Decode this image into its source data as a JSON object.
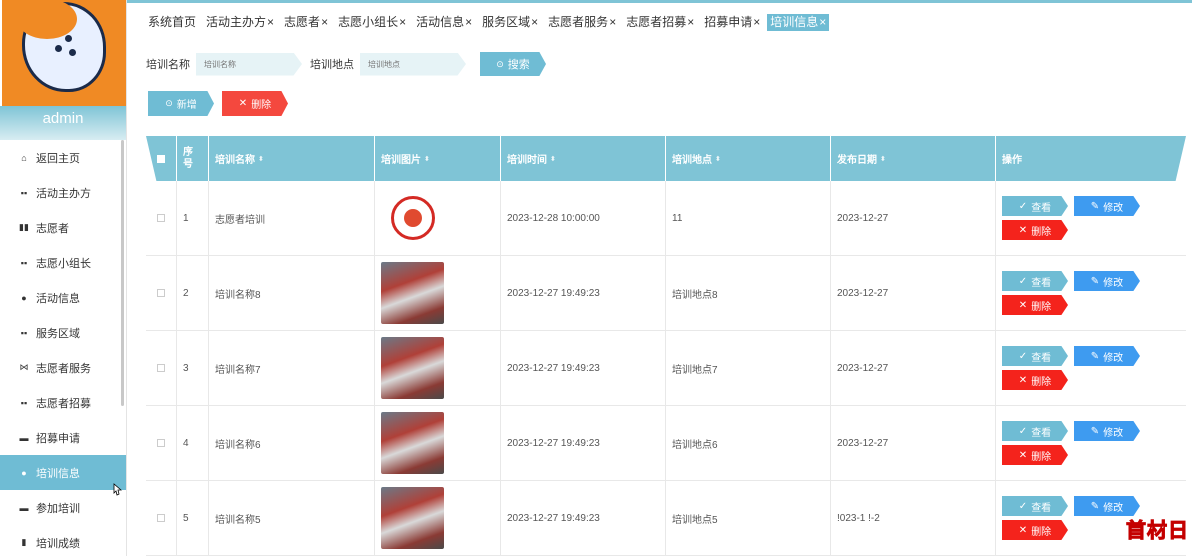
{
  "sidebar": {
    "username": "admin",
    "items": [
      {
        "label": "返回主页",
        "icon": "home-icon",
        "glyph": "⌂"
      },
      {
        "label": "活动主办方",
        "icon": "grid-icon",
        "glyph": "▪▪"
      },
      {
        "label": "志愿者",
        "icon": "building-icon",
        "glyph": "▮▮"
      },
      {
        "label": "志愿小组长",
        "icon": "grid-icon",
        "glyph": "▪▪"
      },
      {
        "label": "活动信息",
        "icon": "location-pin-icon",
        "glyph": "●"
      },
      {
        "label": "服务区域",
        "icon": "grid-icon",
        "glyph": "▪▪"
      },
      {
        "label": "志愿者服务",
        "icon": "bow-icon",
        "glyph": "⋈"
      },
      {
        "label": "志愿者招募",
        "icon": "grid-icon",
        "glyph": "▪▪"
      },
      {
        "label": "招募申请",
        "icon": "briefcase-icon",
        "glyph": "▬"
      },
      {
        "label": "培训信息",
        "icon": "user-icon",
        "glyph": "●",
        "active": true
      },
      {
        "label": "参加培训",
        "icon": "comment-icon",
        "glyph": "▬"
      },
      {
        "label": "培训成绩",
        "icon": "clipboard-icon",
        "glyph": "▮"
      }
    ]
  },
  "tabs": [
    {
      "label": "系统首页",
      "closable": false
    },
    {
      "label": "活动主办方",
      "closable": true
    },
    {
      "label": "志愿者",
      "closable": true
    },
    {
      "label": "志愿小组长",
      "closable": true
    },
    {
      "label": "活动信息",
      "closable": true
    },
    {
      "label": "服务区域",
      "closable": true
    },
    {
      "label": "志愿者服务",
      "closable": true
    },
    {
      "label": "志愿者招募",
      "closable": true
    },
    {
      "label": "招募申请",
      "closable": true
    },
    {
      "label": "培训信息",
      "closable": true,
      "active": true
    }
  ],
  "search": {
    "name_label": "培训名称",
    "name_placeholder": "培训名称",
    "location_label": "培训地点",
    "location_placeholder": "培训地点",
    "search_button": "搜索"
  },
  "actions": {
    "add_button": "新增",
    "delete_button": "删除"
  },
  "table": {
    "columns": [
      "序号",
      "培训名称",
      "培训图片",
      "培训时间",
      "培训地点",
      "发布日期",
      "操作"
    ],
    "view_label": "查看",
    "edit_label": "修改",
    "delete_label": "删除",
    "rows": [
      {
        "index": "1",
        "name": "志愿者培训",
        "image": "logo",
        "time": "2023-12-28 10:00:00",
        "location": "11",
        "date": "2023-12-27"
      },
      {
        "index": "2",
        "name": "培训名称8",
        "image": "photo",
        "time": "2023-12-27 19:49:23",
        "location": "培训地点8",
        "date": "2023-12-27"
      },
      {
        "index": "3",
        "name": "培训名称7",
        "image": "photo",
        "time": "2023-12-27 19:49:23",
        "location": "培训地点7",
        "date": "2023-12-27"
      },
      {
        "index": "4",
        "name": "培训名称6",
        "image": "photo",
        "time": "2023-12-27 19:49:23",
        "location": "培训地点6",
        "date": "2023-12-27"
      },
      {
        "index": "5",
        "name": "培训名称5",
        "image": "photo",
        "time": "2023-12-27 19:49:23",
        "location": "培训地点5",
        "date": "!023-1 !-2"
      }
    ]
  },
  "watermark": "首材日",
  "colors": {
    "accent": "#6fbcd4",
    "header": "#7fc4d6",
    "danger": "#f4483e",
    "edit": "#3e9bf0"
  }
}
